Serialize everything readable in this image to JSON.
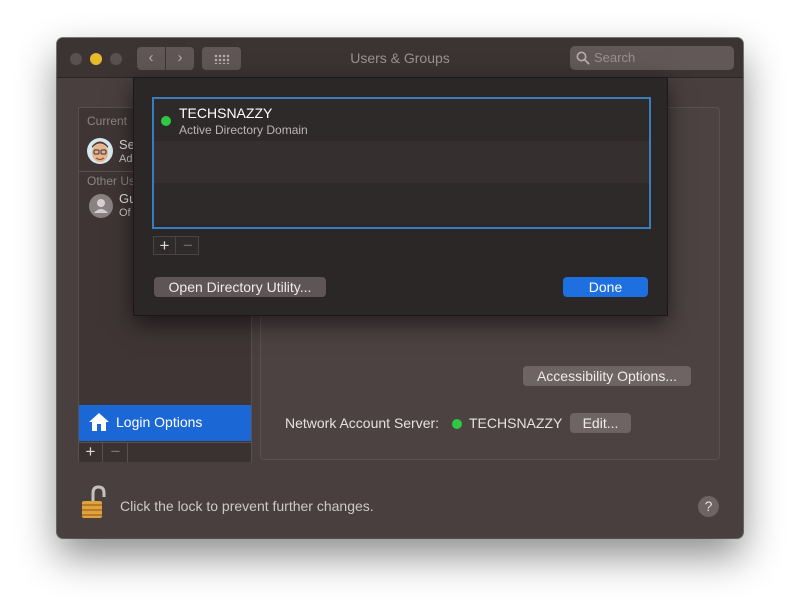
{
  "window": {
    "title": "Users & Groups",
    "search_placeholder": "Search"
  },
  "sidebar": {
    "current_label": "Current",
    "other_label": "Other Us",
    "users": [
      {
        "name": "Se",
        "role": "Adı"
      },
      {
        "name": "Gu",
        "role": "Of"
      }
    ],
    "login_options_label": "Login Options",
    "add_symbol": "+",
    "remove_symbol": "−"
  },
  "main": {
    "accessibility_button": "Accessibility Options...",
    "network_server_label": "Network Account Server:",
    "network_server_value": "TECHSNAZZY",
    "edit_button": "Edit...",
    "status_color": "#2ec843"
  },
  "footer": {
    "lock_text": "Click the lock to prevent further changes.",
    "help_symbol": "?"
  },
  "sheet": {
    "servers": [
      {
        "name": "TECHSNAZZY",
        "type": "Active Directory Domain",
        "status": "connected"
      }
    ],
    "add_symbol": "+",
    "remove_symbol": "−",
    "open_directory_button": "Open Directory Utility...",
    "done_button": "Done"
  },
  "colors": {
    "accent": "#1e6fe0",
    "selection": "#1c67d6",
    "window_bg": "#4a3f3f"
  }
}
